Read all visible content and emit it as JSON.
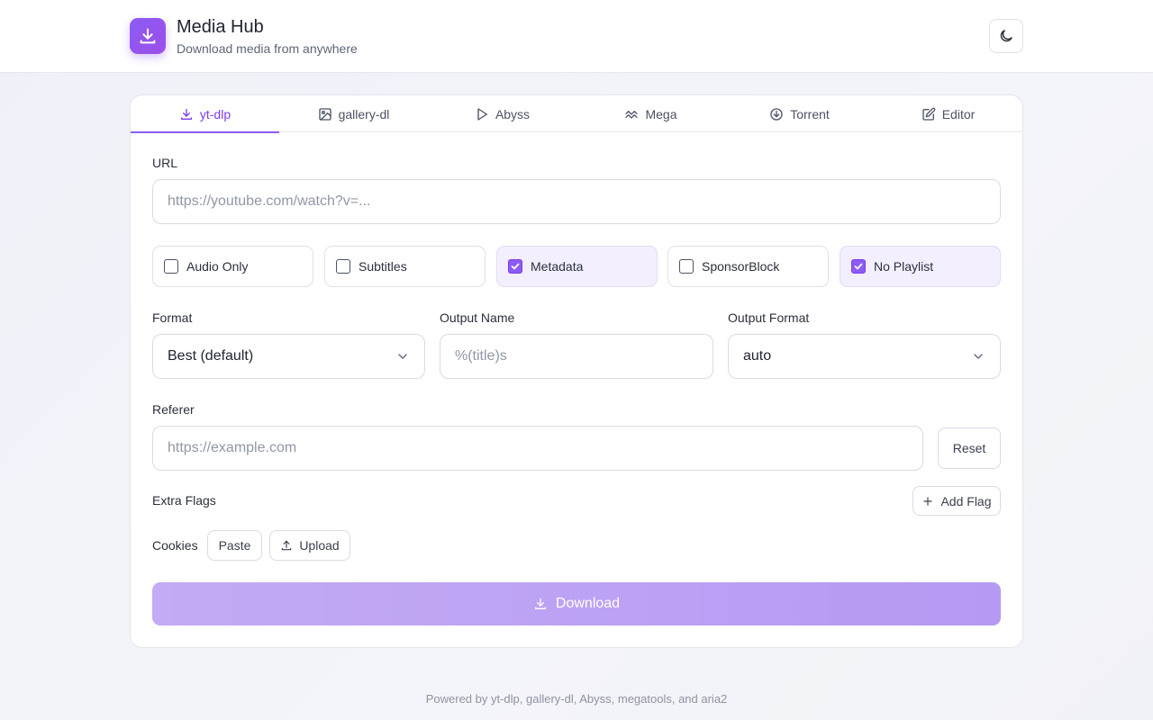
{
  "app": {
    "title": "Media Hub",
    "subtitle": "Download media from anywhere",
    "accent_color": "#8b5cf6",
    "logo_icon": "download-icon",
    "theme_toggle_icon": "moon-icon"
  },
  "tabs": [
    {
      "label": "yt-dlp",
      "icon": "download-icon",
      "active": true
    },
    {
      "label": "gallery-dl",
      "icon": "image-icon",
      "active": false
    },
    {
      "label": "Abyss",
      "icon": "play-icon",
      "active": false
    },
    {
      "label": "Mega",
      "icon": "mega-icon",
      "active": false
    },
    {
      "label": "Torrent",
      "icon": "circle-download-icon",
      "active": false
    },
    {
      "label": "Editor",
      "icon": "edit-icon",
      "active": false
    }
  ],
  "url": {
    "label": "URL",
    "value": "",
    "placeholder": "https://youtube.com/watch?v=..."
  },
  "options": [
    {
      "label": "Audio Only",
      "checked": false
    },
    {
      "label": "Subtitles",
      "checked": false
    },
    {
      "label": "Metadata",
      "checked": true
    },
    {
      "label": "SponsorBlock",
      "checked": false
    },
    {
      "label": "No Playlist",
      "checked": true
    }
  ],
  "format": {
    "label": "Format",
    "selected": "Best (default)"
  },
  "output_name": {
    "label": "Output Name",
    "value": "",
    "placeholder": "%(title)s"
  },
  "output_format": {
    "label": "Output Format",
    "selected": "auto"
  },
  "referer": {
    "label": "Referer",
    "value": "",
    "placeholder": "https://example.com",
    "reset_label": "Reset"
  },
  "extra_flags": {
    "label": "Extra Flags",
    "add_label": "Add Flag"
  },
  "cookies": {
    "label": "Cookies",
    "paste_label": "Paste",
    "upload_label": "Upload"
  },
  "download": {
    "label": "Download"
  },
  "footer": "Powered by yt-dlp, gallery-dl, Abyss, megatools, and aria2"
}
